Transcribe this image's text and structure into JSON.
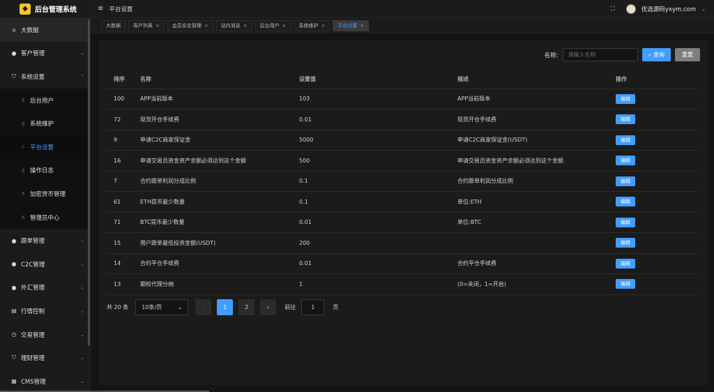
{
  "app": {
    "title": "后台管理系统"
  },
  "header": {
    "breadcrumb": "平台设置",
    "username": "优选源码yxym.com"
  },
  "sidebar": {
    "items": [
      {
        "label": "大数据",
        "icon": "home-icon",
        "caret": ""
      },
      {
        "label": "客户管理",
        "icon": "user-icon",
        "caret": "⌄"
      },
      {
        "label": "系统设置",
        "icon": "shield-icon",
        "caret": "⌃"
      },
      {
        "label": "后台用户",
        "icon": "thumb-icon",
        "caret": "",
        "sub": true
      },
      {
        "label": "系统维护",
        "icon": "thumb-icon",
        "caret": "",
        "sub": true
      },
      {
        "label": "平台设置",
        "icon": "thumb-icon",
        "caret": "",
        "sub": true,
        "active": true
      },
      {
        "label": "操作日志",
        "icon": "thumb-icon",
        "caret": "",
        "sub": true
      },
      {
        "label": "加密货币管理",
        "icon": "thumb-icon",
        "caret": "",
        "sub": true
      },
      {
        "label": "管理员中心",
        "icon": "thumb-icon",
        "caret": "",
        "sub": true
      },
      {
        "label": "跟单管理",
        "icon": "user-icon",
        "caret": "⌄"
      },
      {
        "label": "C2C管理",
        "icon": "user-icon",
        "caret": "⌄"
      },
      {
        "label": "外汇管理",
        "icon": "user-icon",
        "caret": "⌄"
      },
      {
        "label": "行情控制",
        "icon": "chart-icon",
        "caret": "⌄"
      },
      {
        "label": "交易管理",
        "icon": "clock-icon",
        "caret": "⌄"
      },
      {
        "label": "理财管理",
        "icon": "shield-icon",
        "caret": "⌄"
      },
      {
        "label": "CMS管理",
        "icon": "doc-icon",
        "caret": "⌄"
      }
    ]
  },
  "tabs": [
    {
      "label": "大数据",
      "closable": false,
      "active": false
    },
    {
      "label": "客户列表",
      "closable": true,
      "active": false
    },
    {
      "label": "会员实名管理",
      "closable": true,
      "active": false
    },
    {
      "label": "站内消息",
      "closable": true,
      "active": false
    },
    {
      "label": "后台用户",
      "closable": true,
      "active": false
    },
    {
      "label": "系统维护",
      "closable": true,
      "active": false
    },
    {
      "label": "平台设置",
      "closable": true,
      "active": true
    }
  ],
  "search": {
    "label": "名称:",
    "placeholder": "请输入名称",
    "query_label": "查询",
    "reset_label": "重置"
  },
  "table": {
    "headers": [
      "排序",
      "名称",
      "设置值",
      "描述",
      "操作"
    ],
    "edit_label": "编辑",
    "rows": [
      [
        "100",
        "APP当前版本",
        "103",
        "APP当前版本"
      ],
      [
        "72",
        "现货开仓手续费",
        "0.01",
        "现货开仓手续费"
      ],
      [
        "9",
        "申请C2C商家保证金",
        "5000",
        "申请C2C商家保证金(USDT)"
      ],
      [
        "16",
        "申请交易员资金资产余额必须达到这个金额",
        "500",
        "申请交易员资金资产余额必须达到这个金额"
      ],
      [
        "7",
        "合约跟单利润分成比例",
        "0.1",
        "合约跟单利润分成比例"
      ],
      [
        "61",
        "ETH提币最少数量",
        "0.1",
        "单位:ETH"
      ],
      [
        "71",
        "BTC提币最少数量",
        "0.01",
        "单位:BTC"
      ],
      [
        "15",
        "用户跟单最低投资金额(USDT)",
        "200",
        ""
      ],
      [
        "14",
        "合约平仓手续费",
        "0.01",
        "合约平仓手续费"
      ],
      [
        "13",
        "期权代理分佣",
        "1",
        "(0=关闭，1=开启)"
      ]
    ]
  },
  "pagination": {
    "total": "共 20 条",
    "page_size": "10条/页",
    "pages": [
      "1",
      "2"
    ],
    "current": "1",
    "goto_label": "前往",
    "goto_value": "1",
    "page_suffix": "页"
  },
  "colors": {
    "accent": "#409eff",
    "bg": "#141414",
    "panel": "#1b1b1b",
    "logo": "#f3c623"
  }
}
